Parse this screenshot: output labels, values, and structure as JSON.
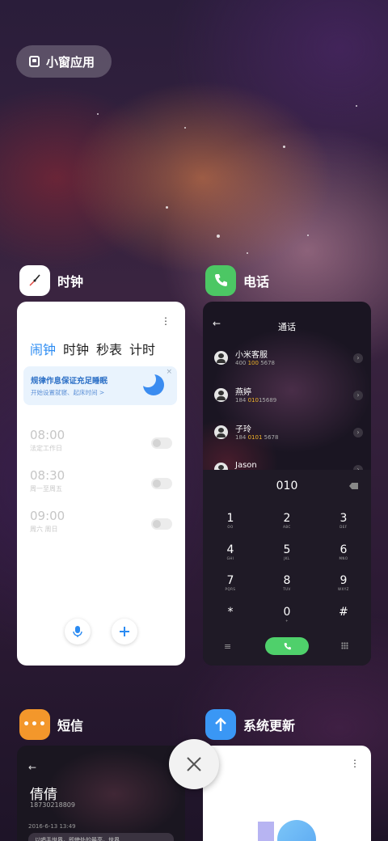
{
  "small_window": {
    "label": "小窗应用",
    "icon": "small-window-icon"
  },
  "apps": [
    {
      "name": "时钟",
      "icon": "clock-icon"
    },
    {
      "name": "电话",
      "icon": "phone-icon",
      "color": "#4cc764"
    },
    {
      "name": "短信",
      "icon": "message-icon",
      "color": "#f3972b"
    },
    {
      "name": "系统更新",
      "icon": "update-arrow-icon",
      "color": "#3a97f5"
    }
  ],
  "clock": {
    "tabs": [
      "闹钟",
      "时钟",
      "秒表",
      "计时"
    ],
    "active_tab": 0,
    "banner_title": "规律作息保证充足睡眠",
    "banner_sub": "开始设置就寝、起床时间 >",
    "alarms": [
      {
        "time": "08:00",
        "repeat": "法定工作日",
        "enabled": false
      },
      {
        "time": "08:30",
        "repeat": "周一至周五",
        "enabled": false
      },
      {
        "time": "09:00",
        "repeat": "周六 周日",
        "enabled": false
      }
    ]
  },
  "phone": {
    "title": "通话",
    "dialed": "010",
    "contacts": [
      {
        "name": "小米客服",
        "pre": "400 ",
        "hl": "100",
        "post": " 5678"
      },
      {
        "name": "燕婷",
        "pre": "184 ",
        "hl": "010",
        "post": "15689"
      },
      {
        "name": "子玲",
        "pre": "184 ",
        "hl": "0101",
        "post": " 5678"
      },
      {
        "name": "Jason",
        "pre": "",
        "hl": "",
        "post": ""
      }
    ],
    "keys": [
      {
        "d": "1",
        "l": "OO"
      },
      {
        "d": "2",
        "l": "ABC"
      },
      {
        "d": "3",
        "l": "DEF"
      },
      {
        "d": "4",
        "l": "GHI"
      },
      {
        "d": "5",
        "l": "JKL"
      },
      {
        "d": "6",
        "l": "MNO"
      },
      {
        "d": "7",
        "l": "PQRS"
      },
      {
        "d": "8",
        "l": "TUV"
      },
      {
        "d": "9",
        "l": "WXYZ"
      },
      {
        "d": "*",
        "l": ""
      },
      {
        "d": "0",
        "l": "+"
      },
      {
        "d": "#",
        "l": ""
      }
    ]
  },
  "sms": {
    "contact": "倩倩",
    "number": "18730218809",
    "date": "2016-6-13 13:49",
    "preview": "以唱手世界，即使处的最亮，世界"
  },
  "colors": {
    "accent": "#2b8bf2",
    "call_green": "#4fd06b",
    "highlight": "#f0b429"
  }
}
